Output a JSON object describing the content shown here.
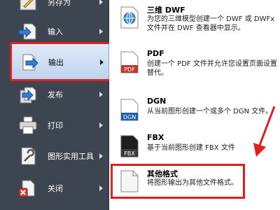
{
  "left_menu": {
    "items": [
      {
        "label": "另存为"
      },
      {
        "label": "输入"
      },
      {
        "label": "输出"
      },
      {
        "label": "发布"
      },
      {
        "label": "打印"
      },
      {
        "label": "图形实用工具"
      },
      {
        "label": "关闭"
      }
    ],
    "active_item": "输出"
  },
  "export_panel": {
    "entries": [
      {
        "title": "三维 DWF",
        "description": "为您的三维模型创建一个 DWF 或 DWFx 文件并在 DWF 查看器中显示。",
        "icon": "globe-document-icon"
      },
      {
        "title": "PDF",
        "description": "创建一个 PDF 文件并允许您设置页面设置替代。",
        "icon": "pdf-icon",
        "icon_label": "PDF"
      },
      {
        "title": "DGN",
        "description": "从当前图形创建一个或多个 DGN 文件。",
        "icon": "dgn-icon",
        "icon_label": "DGN"
      },
      {
        "title": "FBX",
        "description": "基于当前图形创建 FBX 文件",
        "icon": "fbx-icon",
        "icon_label": "FBX"
      },
      {
        "title": "其他格式",
        "description": "将图形输出为其他文件格式。",
        "icon": "blank-document-icon"
      }
    ]
  },
  "colors": {
    "menu_background": "#3d4551",
    "active_highlight": "#bcd3ee",
    "annotation_red": "#e02020",
    "pdf_badge": "#c0392b",
    "dgn_badge": "#1f5fa8",
    "fbx_badge": "#3a3a3a"
  }
}
